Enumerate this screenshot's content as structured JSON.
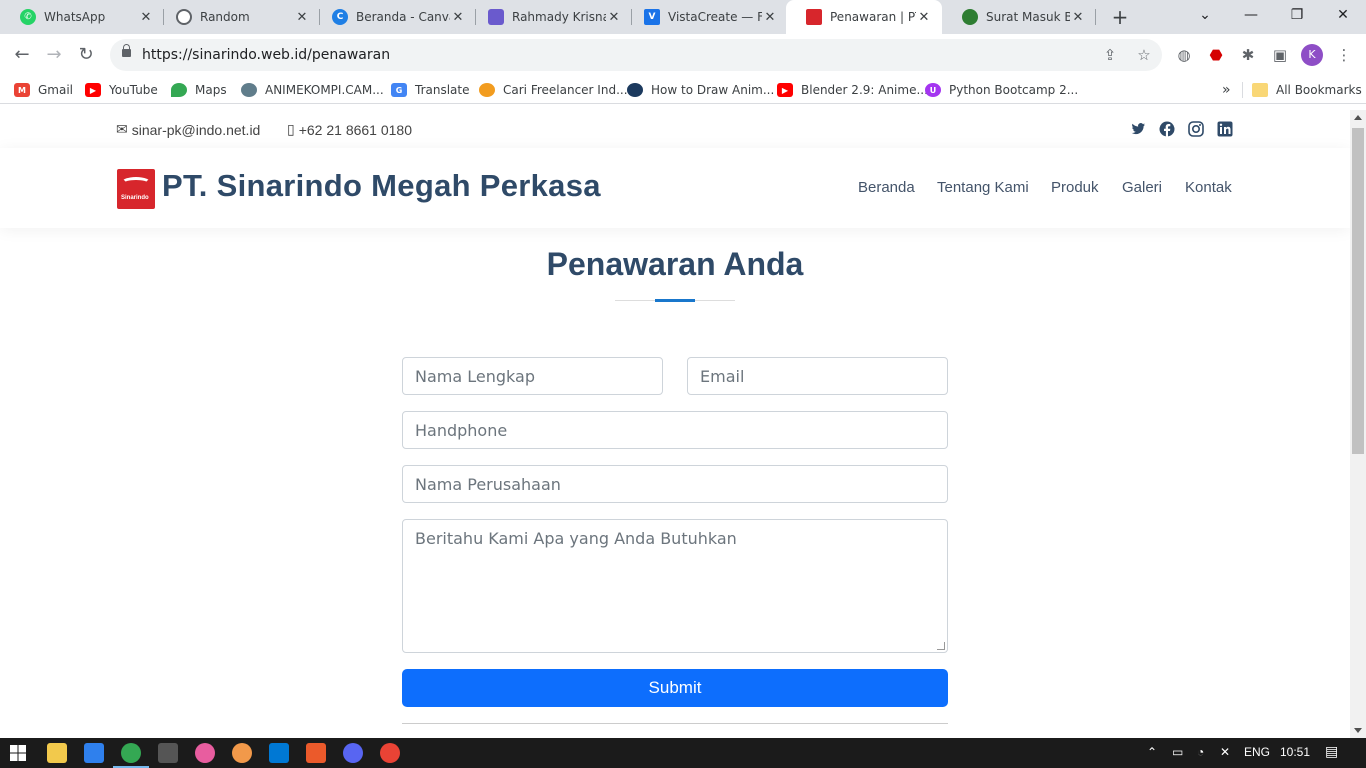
{
  "browser": {
    "tabs": [
      {
        "title": "WhatsApp",
        "icon": "whatsapp-icon",
        "color": "#25d366"
      },
      {
        "title": "Random",
        "icon": "chatgpt-icon",
        "color": "#5f6368"
      },
      {
        "title": "Beranda - Canva",
        "icon": "canva-icon",
        "color": "#1f7fe5"
      },
      {
        "title": "Rahmady Krisna",
        "icon": "printer-icon",
        "color": "#6a5acd"
      },
      {
        "title": "VistaCreate — F",
        "icon": "vistacreate-icon",
        "color": "#1a73e8"
      },
      {
        "title": "Penawaran | PT.",
        "icon": "sinarindo-icon",
        "color": "#d7262c"
      },
      {
        "title": "Surat Masuk Bar",
        "icon": "globe-icon",
        "color": "#2e7d32"
      }
    ],
    "close_glyph": "✕",
    "new_tab_glyph": "+",
    "url": "https://sinarindo.web.id/penawaran",
    "profile_initial": "K",
    "bookmarks": [
      {
        "label": "Gmail",
        "color": "#ea4335"
      },
      {
        "label": "YouTube",
        "color": "#ff0000"
      },
      {
        "label": "Maps",
        "color": "#34a853"
      },
      {
        "label": "ANIMEKOMPI.CAM...",
        "color": "#607d8b"
      },
      {
        "label": "Translate",
        "color": "#4285f4"
      },
      {
        "label": "Cari Freelancer Ind...",
        "color": "#f29c1f"
      },
      {
        "label": "How to Draw Anim...",
        "color": "#1c3a5e"
      },
      {
        "label": "Blender 2.9: Anime...",
        "color": "#ff0000"
      },
      {
        "label": "Python Bootcamp 2...",
        "color": "#a435f0"
      }
    ],
    "more_glyph": "»",
    "all_bookmarks": "All Bookmarks"
  },
  "site": {
    "email": "sinar-pk@indo.net.id",
    "phone": "+62 21 8661 0180",
    "brand": "PT. Sinarindo Megah Perkasa",
    "logo_text": "Sinarindo",
    "nav": [
      "Beranda",
      "Tentang Kami",
      "Produk",
      "Galeri",
      "Kontak"
    ],
    "social": [
      {
        "name": "twitter-icon",
        "color": "#2f4a68"
      },
      {
        "name": "facebook-icon",
        "color": "#2f4a68"
      },
      {
        "name": "instagram-icon",
        "color": "#2f4a68"
      },
      {
        "name": "linkedin-icon",
        "color": "#2f4a68"
      }
    ]
  },
  "form": {
    "heading": "Penawaran Anda",
    "name_placeholder": "Nama Lengkap",
    "email_placeholder": "Email",
    "phone_placeholder": "Handphone",
    "company_placeholder": "Nama Perusahaan",
    "message_placeholder": "Beritahu Kami Apa yang Anda Butuhkan",
    "submit_label": "Submit"
  },
  "taskbar": {
    "lang": "ENG",
    "time": "10:51"
  },
  "colors": {
    "brand_navy": "#2f4a68",
    "accent_blue": "#1977cc",
    "submit_blue": "#0d6efd",
    "logo_red": "#d7262c"
  }
}
